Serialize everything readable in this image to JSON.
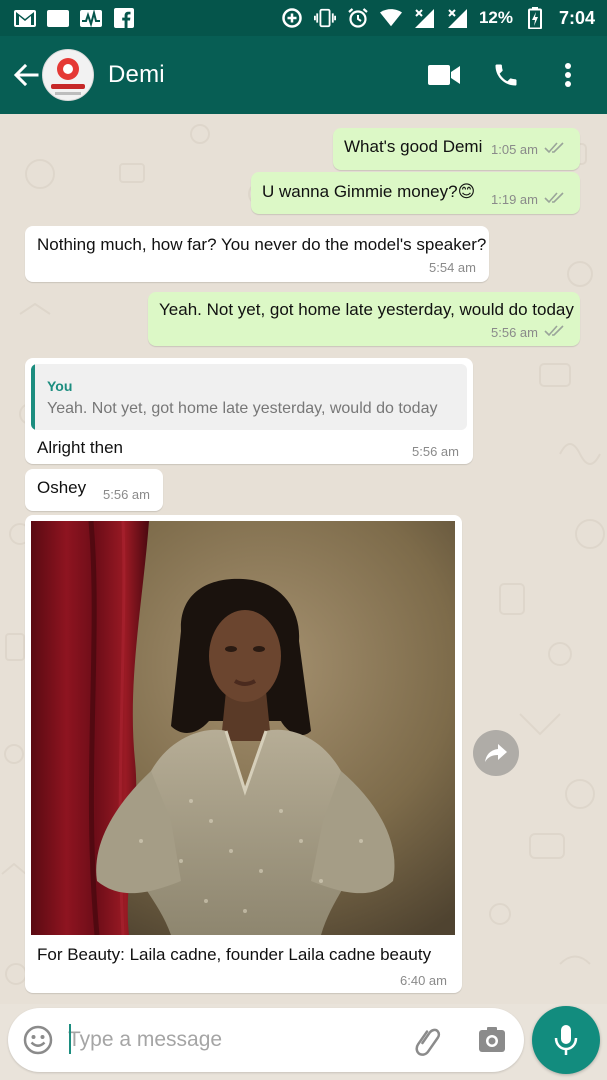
{
  "status_bar": {
    "left_icons": [
      "gmail-icon",
      "ge-app-icon",
      "activity-app-icon",
      "facebook-icon"
    ],
    "ge_label": "GE",
    "right_icons": [
      "data-saver-icon",
      "vibrate-icon",
      "alarm-icon",
      "wifi-icon",
      "signal-x-icon",
      "signal-icon",
      "battery-icon"
    ],
    "battery": "12%",
    "time": "7:04"
  },
  "header": {
    "contact_name": "Demi",
    "icons": [
      "back-arrow-icon",
      "video-call-icon",
      "phone-icon",
      "more-vert-icon"
    ]
  },
  "messages": [
    {
      "direction": "out",
      "text": "What's good Demi",
      "time": "1:05 am"
    },
    {
      "direction": "out",
      "text": "U wanna Gimmie money?😊",
      "time": "1:19 am"
    },
    {
      "direction": "in",
      "text": "Nothing much, how far? You never do the model's speaker?",
      "time": "5:54 am"
    },
    {
      "direction": "out",
      "text": "Yeah. Not yet, got home late yesterday, would do today",
      "time": "5:56 am"
    },
    {
      "direction": "in",
      "quote_author": "You",
      "quote_text": "Yeah. Not yet, got home late yesterday, would do today",
      "text": "Alright then",
      "time": "5:56 am"
    },
    {
      "direction": "in",
      "text": "Oshey",
      "time": "5:56 am"
    },
    {
      "direction": "in",
      "type": "image",
      "caption": "For Beauty: Laila cadne, founder Laila cadne beauty",
      "time": "6:40 am"
    }
  ],
  "composer": {
    "placeholder": "Type a message",
    "icons": [
      "emoji-icon",
      "attach-icon",
      "camera-icon",
      "mic-icon"
    ]
  },
  "colors": {
    "header": "#075e54",
    "status_bar": "#05554b",
    "outgoing_bubble": "#dcf8c6",
    "incoming_bubble": "#ffffff",
    "accent": "#128c7e"
  }
}
